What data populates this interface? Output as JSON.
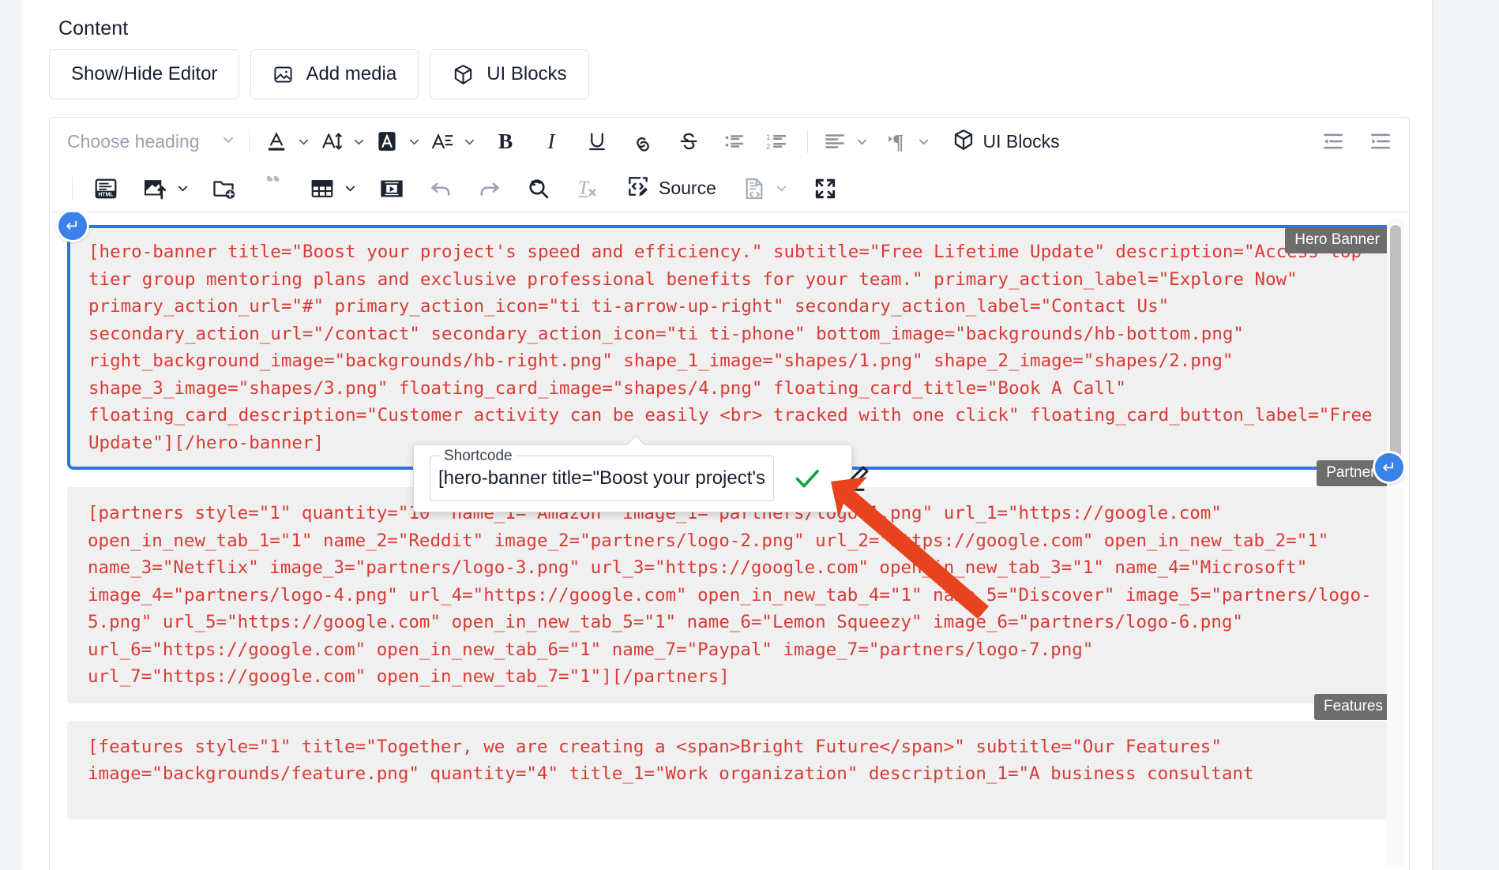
{
  "section": {
    "label": "Content"
  },
  "top_buttons": [
    {
      "label": "Show/Hide Editor",
      "icon": "none"
    },
    {
      "label": "Add media",
      "icon": "image-icon"
    },
    {
      "label": "UI Blocks",
      "icon": "cube-icon"
    }
  ],
  "toolbar": {
    "heading_placeholder": "Choose heading",
    "row1": [
      {
        "name": "font-color",
        "icon": "font-color-icon",
        "has_chevron": true
      },
      {
        "name": "font-size",
        "icon": "font-size-icon",
        "has_chevron": true
      },
      {
        "name": "background-color",
        "icon": "background-color-icon",
        "has_chevron": true
      },
      {
        "name": "font-family",
        "icon": "font-family-icon",
        "has_chevron": true
      },
      {
        "name": "bold",
        "icon": "bold-icon",
        "has_chevron": false
      },
      {
        "name": "italic",
        "icon": "italic-icon",
        "has_chevron": false
      },
      {
        "name": "underline",
        "icon": "underline-icon",
        "has_chevron": false
      },
      {
        "name": "link",
        "icon": "link-icon",
        "has_chevron": false
      },
      {
        "name": "strikethrough",
        "icon": "strikethrough-icon",
        "has_chevron": false
      },
      {
        "name": "bulleted-list",
        "icon": "bulleted-list-icon",
        "has_chevron": false
      },
      {
        "name": "numbered-list",
        "icon": "numbered-list-icon",
        "has_chevron": false
      },
      {
        "name": "text-align",
        "icon": "align-left-icon",
        "has_chevron": true
      },
      {
        "name": "text-direction",
        "icon": "paragraph-direction-icon",
        "has_chevron": true
      }
    ],
    "ui_blocks_label": "UI Blocks",
    "row1_right": [
      {
        "name": "decrease-indent",
        "icon": "outdent-icon"
      },
      {
        "name": "increase-indent",
        "icon": "indent-icon"
      }
    ],
    "row2": [
      {
        "name": "html-embed",
        "icon": "html-icon",
        "has_chevron": false
      },
      {
        "name": "insert-image",
        "icon": "image-upload-icon",
        "has_chevron": true
      },
      {
        "name": "insert-from-folder",
        "icon": "folder-add-icon",
        "has_chevron": false
      },
      {
        "name": "blockquote",
        "icon": "quote-icon",
        "has_chevron": false
      },
      {
        "name": "insert-table",
        "icon": "table-icon",
        "has_chevron": true
      },
      {
        "name": "insert-media",
        "icon": "media-icon",
        "has_chevron": false
      },
      {
        "name": "undo",
        "icon": "undo-icon",
        "has_chevron": false
      },
      {
        "name": "redo",
        "icon": "redo-icon",
        "has_chevron": false
      },
      {
        "name": "find-replace",
        "icon": "find-replace-icon",
        "has_chevron": false
      },
      {
        "name": "remove-format",
        "icon": "remove-format-icon",
        "has_chevron": false
      }
    ],
    "source_label": "Source",
    "row2_after_source": [
      {
        "name": "document-source",
        "icon": "document-code-icon",
        "has_chevron": true
      },
      {
        "name": "fullscreen",
        "icon": "fullscreen-icon",
        "has_chevron": false
      }
    ]
  },
  "blocks": [
    {
      "badge": "Hero Banner",
      "selected": true,
      "code": "[hero-banner title=\"Boost your project's speed and efficiency.\" subtitle=\"Free Lifetime Update\" description=\"Access top-tier group mentoring plans and exclusive professional benefits for your team.\" primary_action_label=\"Explore Now\" primary_action_url=\"#\" primary_action_icon=\"ti ti-arrow-up-right\" secondary_action_label=\"Contact Us\" secondary_action_url=\"/contact\" secondary_action_icon=\"ti ti-phone\" bottom_image=\"backgrounds/hb-bottom.png\" right_background_image=\"backgrounds/hb-right.png\" shape_1_image=\"shapes/1.png\" shape_2_image=\"shapes/2.png\" shape_3_image=\"shapes/3.png\" floating_card_image=\"shapes/4.png\" floating_card_title=\"Book A Call\" floating_card_description=\"Customer activity can be easily <br> tracked with one click\" floating_card_button_label=\"Free Update\"][/hero-banner]"
    },
    {
      "badge": "Partners",
      "selected": false,
      "code": "[partners style=\"1\" quantity=\"10\" name_1=\"Amazon\" image_1=\"partners/logo-1.png\" url_1=\"https://google.com\" open_in_new_tab_1=\"1\" name_2=\"Reddit\" image_2=\"partners/logo-2.png\" url_2=\"https://google.com\" open_in_new_tab_2=\"1\" name_3=\"Netflix\" image_3=\"partners/logo-3.png\" url_3=\"https://google.com\" open_in_new_tab_3=\"1\" name_4=\"Microsoft\" image_4=\"partners/logo-4.png\" url_4=\"https://google.com\" open_in_new_tab_4=\"1\" name_5=\"Discover\" image_5=\"partners/logo-5.png\" url_5=\"https://google.com\" open_in_new_tab_5=\"1\" name_6=\"Lemon Squeezy\" image_6=\"partners/logo-6.png\" url_6=\"https://google.com\" open_in_new_tab_6=\"1\" name_7=\"Paypal\" image_7=\"partners/logo-7.png\" url_7=\"https://google.com\" open_in_new_tab_7=\"1\"][/partners]"
    },
    {
      "badge": "Features",
      "selected": false,
      "code": "[features style=\"1\" title=\"Together, we are creating a <span>Bright Future</span>\" subtitle=\"Our Features\" image=\"backgrounds/feature.png\" quantity=\"4\" title_1=\"Work organization\" description_1=\"A business consultant"
    }
  ],
  "popup": {
    "legend": "Shortcode",
    "value": "[hero-banner title=\"Boost your project's",
    "confirm_icon": "check-icon",
    "edit_icon": "pencil-icon"
  },
  "colors": {
    "accent": "#2f74e0",
    "code_red": "#d93b36",
    "badge_grey": "#6d6d6d",
    "check_green": "#12a33b",
    "arrow_red": "#e8431f"
  }
}
